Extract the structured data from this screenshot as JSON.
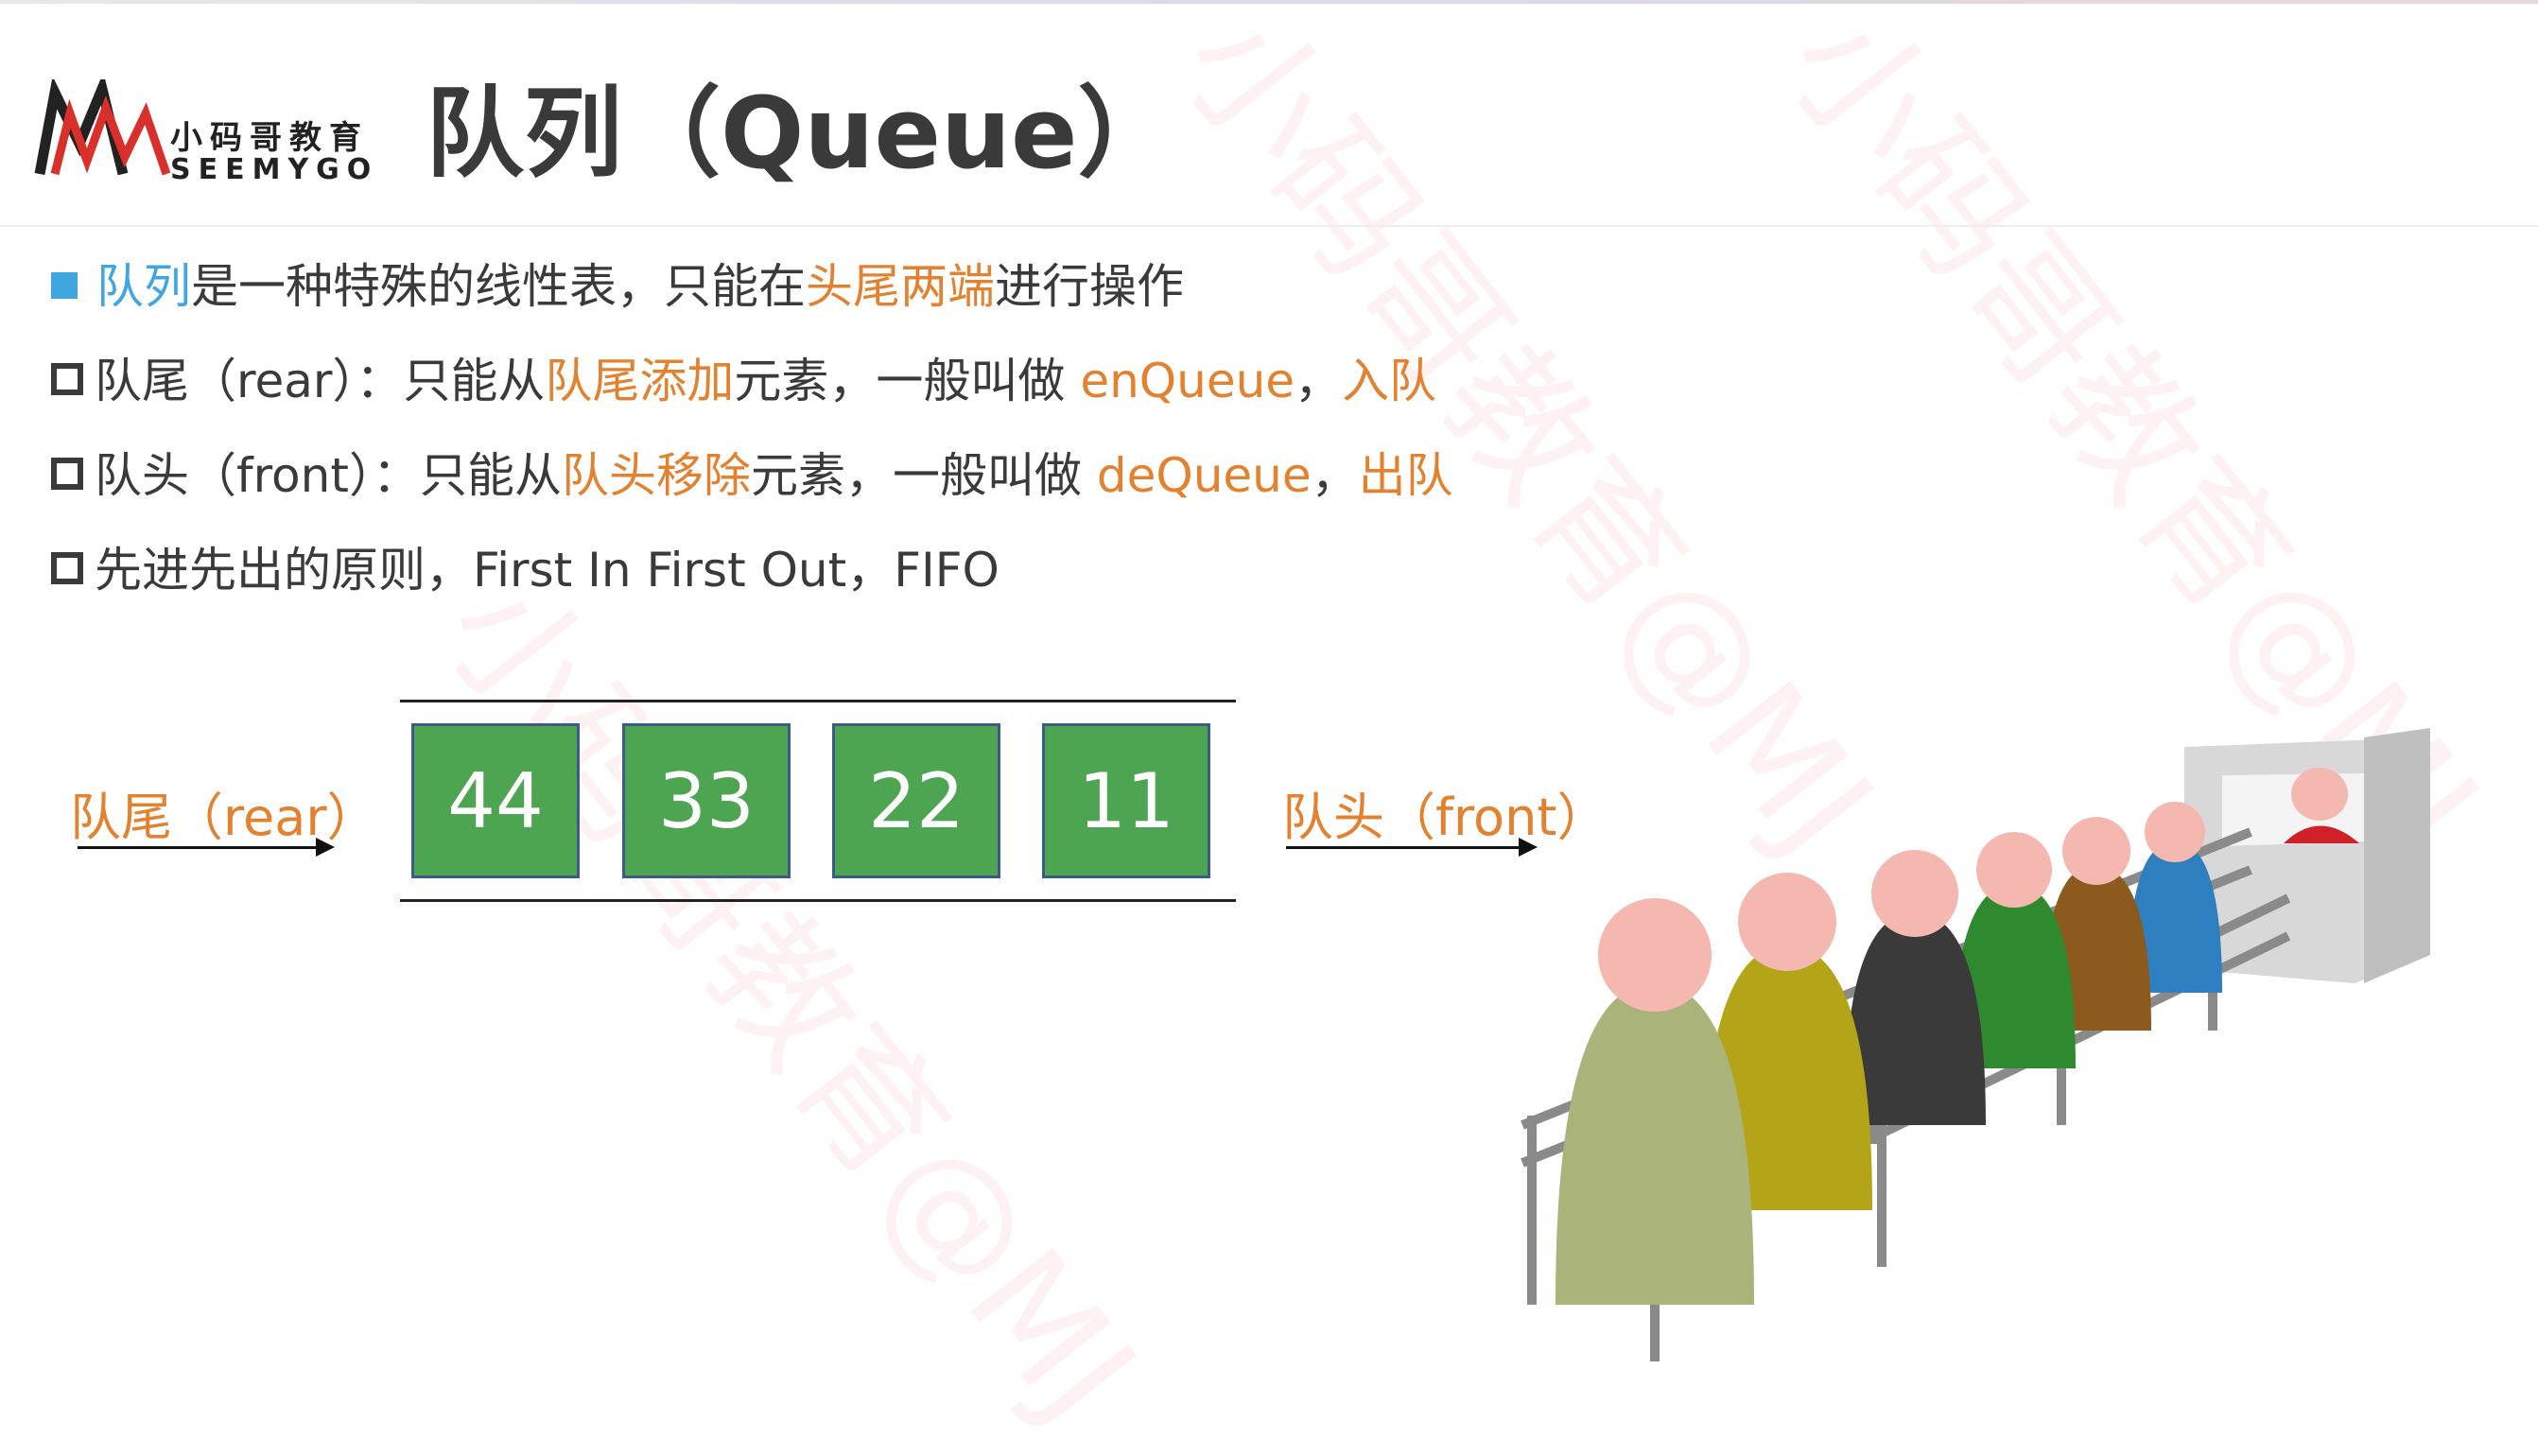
{
  "header": {
    "logo_cn": "小码哥教育",
    "logo_en": "SEEMYGO",
    "title": "队列（Queue）"
  },
  "bullets": [
    {
      "icon": "filled-square",
      "parts": [
        {
          "text": "队列",
          "color": "blue"
        },
        {
          "text": "是一种特殊的线性表，只能在",
          "color": "default"
        },
        {
          "text": "头尾两端",
          "color": "orange"
        },
        {
          "text": "进行操作",
          "color": "default"
        }
      ]
    },
    {
      "icon": "hollow-square",
      "parts": [
        {
          "text": "队尾（rear）：只能从",
          "color": "default"
        },
        {
          "text": "队尾添加",
          "color": "orange"
        },
        {
          "text": "元素，一般叫做 ",
          "color": "default"
        },
        {
          "text": "enQueue",
          "color": "orange"
        },
        {
          "text": "，",
          "color": "default"
        },
        {
          "text": "入队",
          "color": "orange"
        }
      ]
    },
    {
      "icon": "hollow-square",
      "parts": [
        {
          "text": "队头（front）：只能从",
          "color": "default"
        },
        {
          "text": "队头移除",
          "color": "orange"
        },
        {
          "text": "元素，一般叫做 ",
          "color": "default"
        },
        {
          "text": "deQueue",
          "color": "orange"
        },
        {
          "text": "，",
          "color": "default"
        },
        {
          "text": "出队",
          "color": "orange"
        }
      ]
    },
    {
      "icon": "hollow-square",
      "parts": [
        {
          "text": "先进先出的原则，First In First Out，FIFO",
          "color": "default"
        }
      ]
    }
  ],
  "queue": {
    "rear_label": "队尾（rear）",
    "front_label": "队头（front）",
    "items": [
      "44",
      "33",
      "22",
      "11"
    ]
  },
  "watermark": "小码哥教育@MJ",
  "colors": {
    "accent_blue": "#3fa6df",
    "accent_orange": "#e4812f",
    "cell_green": "#4ea551",
    "text_dark": "#3a3a3a"
  },
  "illustration": "people-queue-at-counter"
}
